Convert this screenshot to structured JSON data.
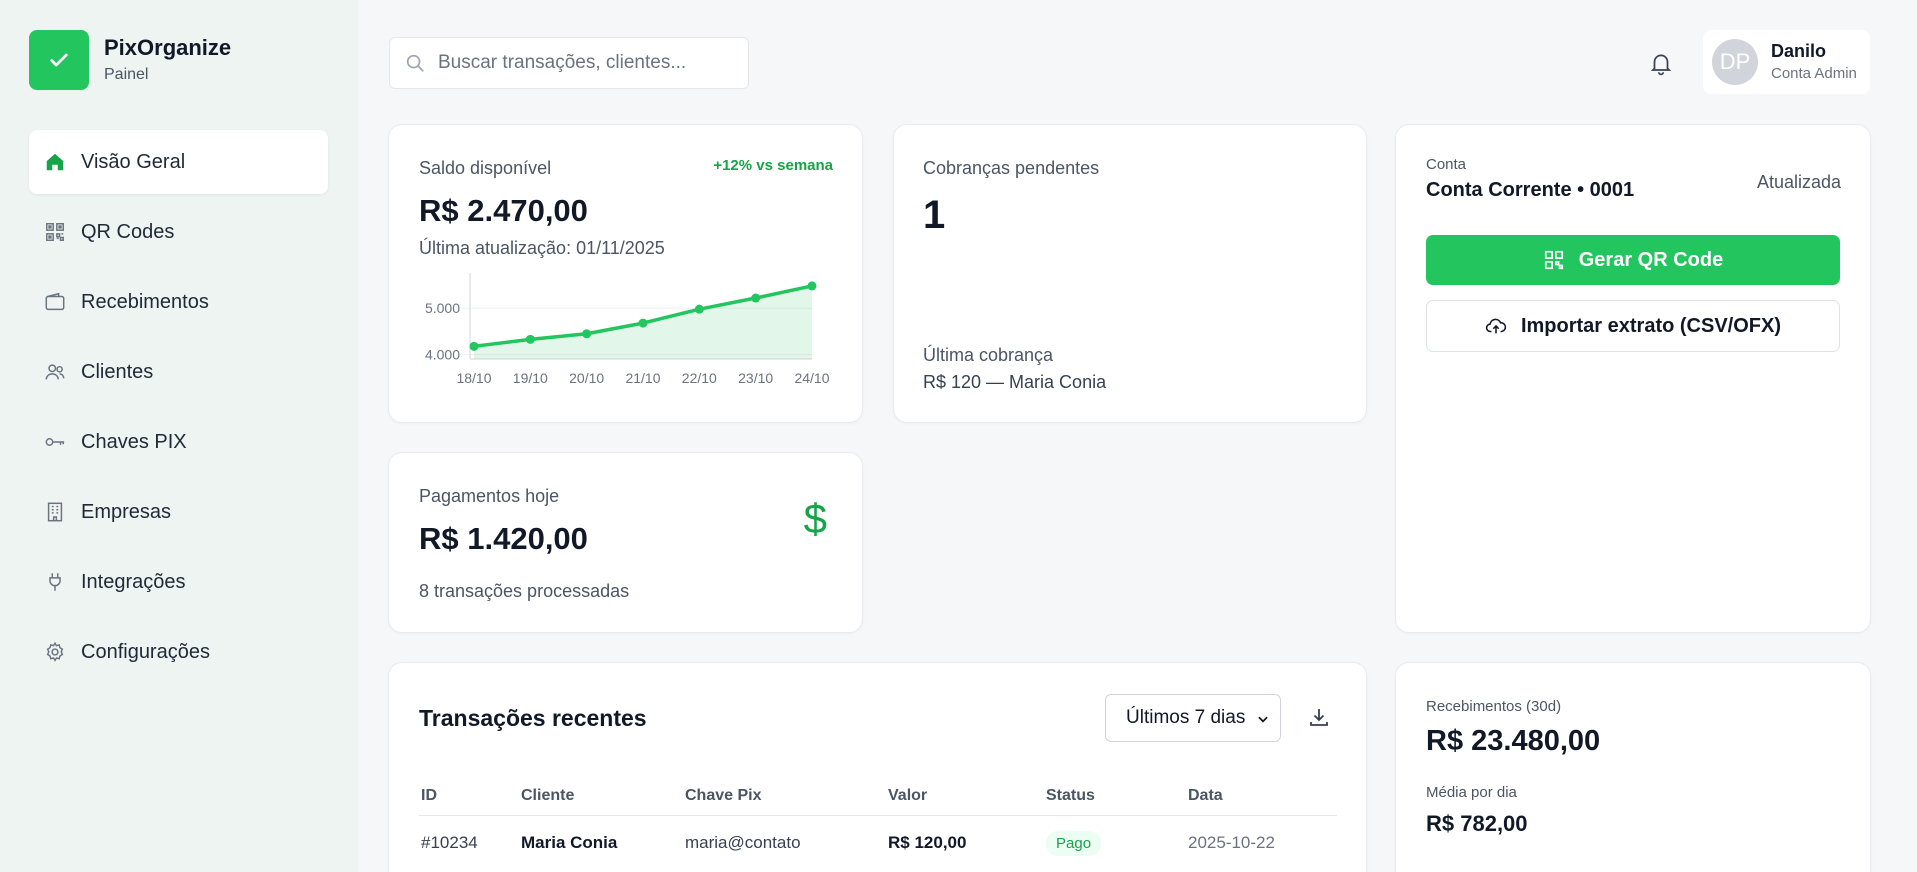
{
  "brand": {
    "name": "PixOrganize",
    "subtitle": "Painel"
  },
  "sidebar": {
    "items": [
      {
        "label": "Visão Geral",
        "icon": "home-icon",
        "active": true
      },
      {
        "label": "QR Codes",
        "icon": "qr-code-icon"
      },
      {
        "label": "Recebimentos",
        "icon": "wallet-icon"
      },
      {
        "label": "Clientes",
        "icon": "users-icon"
      },
      {
        "label": "Chaves PIX",
        "icon": "key-icon"
      },
      {
        "label": "Empresas",
        "icon": "building-icon"
      },
      {
        "label": "Integrações",
        "icon": "plug-icon"
      },
      {
        "label": "Configurações",
        "icon": "gear-icon"
      }
    ]
  },
  "header": {
    "search_placeholder": "Buscar transações, clientes...",
    "user": {
      "initials": "DP",
      "name": "Danilo",
      "role": "Conta Admin"
    }
  },
  "saldo": {
    "label": "Saldo disponível",
    "trend": "+12% vs semana",
    "value": "R$ 2.470,00",
    "updated": "Última atualização: 01/11/2025"
  },
  "chart_data": {
    "type": "area",
    "x": [
      "18/10",
      "19/10",
      "20/10",
      "21/10",
      "22/10",
      "23/10",
      "24/10"
    ],
    "series": [
      {
        "values": [
          4180,
          4330,
          4450,
          4680,
          4980,
          5220,
          5480
        ]
      }
    ],
    "yticks": [
      "5.000",
      "4.000"
    ],
    "ytick_values": [
      5000,
      4000
    ],
    "ylim": [
      3950,
      5500
    ],
    "grid": true,
    "color": "#22c55e"
  },
  "cobrancas": {
    "label": "Cobranças pendentes",
    "value": "1",
    "last_label": "Última cobrança",
    "last_value": "R$ 120 — Maria Conia"
  },
  "pagamentos": {
    "label": "Pagamentos hoje",
    "value": "R$ 1.420,00",
    "sub": "8 transações processadas",
    "symbol": "$"
  },
  "conta": {
    "label": "Conta",
    "name": "Conta Corrente • 0001",
    "status": "Atualizada",
    "primary_button": "Gerar QR Code",
    "secondary_button": "Importar extrato (CSV/OFX)"
  },
  "transacoes": {
    "title": "Transações recentes",
    "filter": "Últimos 7 dias",
    "columns": [
      "ID",
      "Cliente",
      "Chave Pix",
      "Valor",
      "Status",
      "Data"
    ],
    "rows": [
      {
        "id": "#10234",
        "cliente": "Maria Conia",
        "chave": "maria@contato",
        "valor": "R$ 120,00",
        "status": "Pago",
        "data": "2025-10-22"
      }
    ]
  },
  "recebimentos": {
    "label": "Recebimentos (30d)",
    "value": "R$ 23.480,00",
    "avg_label": "Média por dia",
    "avg_value": "R$ 782,00"
  },
  "colors": {
    "accent": "#22c55e",
    "accent_dark": "#16a34a"
  }
}
